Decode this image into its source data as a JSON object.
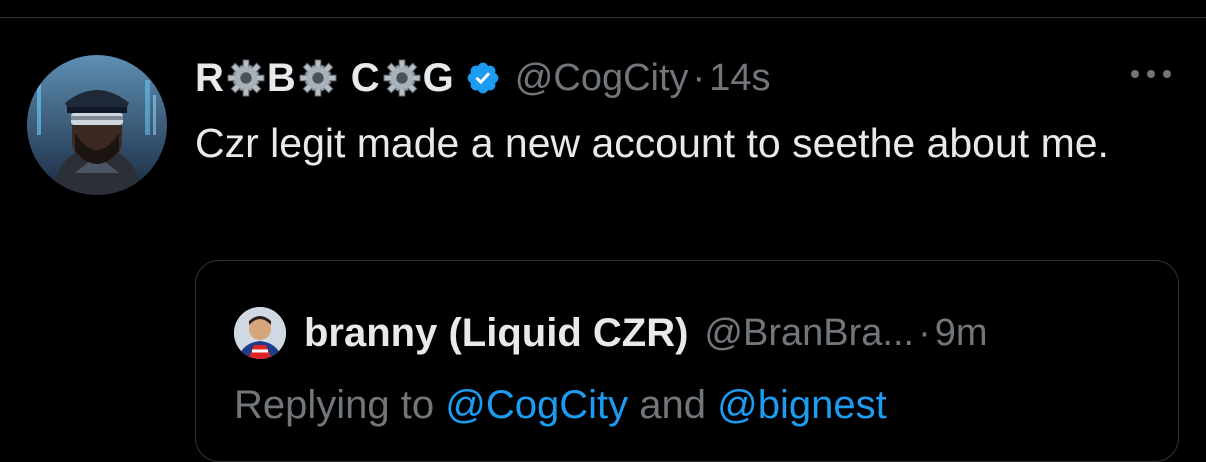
{
  "tweet": {
    "display_name_parts": [
      "R",
      "B",
      "C",
      "G"
    ],
    "handle": "@CogCity",
    "time": "14s",
    "text": "Czr legit made a new account to seethe about me."
  },
  "quote": {
    "name": "branny (Liquid CZR)",
    "handle": "@BranBra...",
    "time": "9m",
    "text_prefix": "Replying to",
    "mention_1": "@CogCity",
    "text_middle": "and",
    "mention_2": "@bignest"
  },
  "colors": {
    "background": "#000000",
    "text_primary": "#e7e9ea",
    "text_secondary": "#71767b",
    "verified_blue": "#1d9bf0",
    "border": "#2f3336"
  },
  "icons": [
    "gear-icon",
    "verified-badge-icon",
    "more-options-icon"
  ]
}
